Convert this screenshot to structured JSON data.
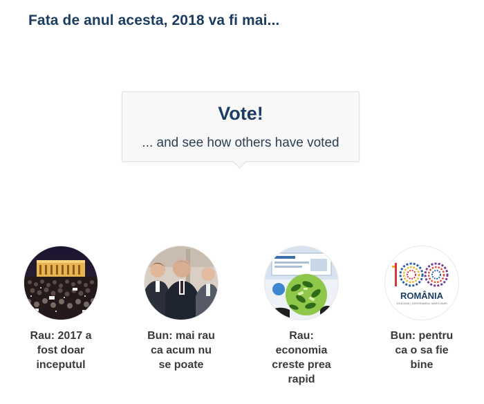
{
  "poll": {
    "question": "Fata de anul acesta, 2018 va fi mai...",
    "vote_heading": "Vote!",
    "vote_subtext": "... and see how others have voted"
  },
  "options": [
    {
      "label": "Rau: 2017 a fost doar inceputul",
      "image": "night-protest-crowd-photo"
    },
    {
      "label": "Bun: mai rau ca acum nu se poate",
      "image": "politicians-in-suits-photo"
    },
    {
      "label": "Rau: economia creste prea rapid",
      "image": "growing-money-plant-photo"
    },
    {
      "label": "Bun: pentru ca o sa fie bine",
      "image": "romania-100-logo"
    }
  ],
  "logo": {
    "number": "100",
    "text": "ROMÂNIA",
    "tagline": "1918-2018 | CENTENARUL MARII UNIRI"
  },
  "colors": {
    "title": "#1c3d62",
    "label": "#3a3a3a",
    "box_background": "#f8f8f8"
  }
}
